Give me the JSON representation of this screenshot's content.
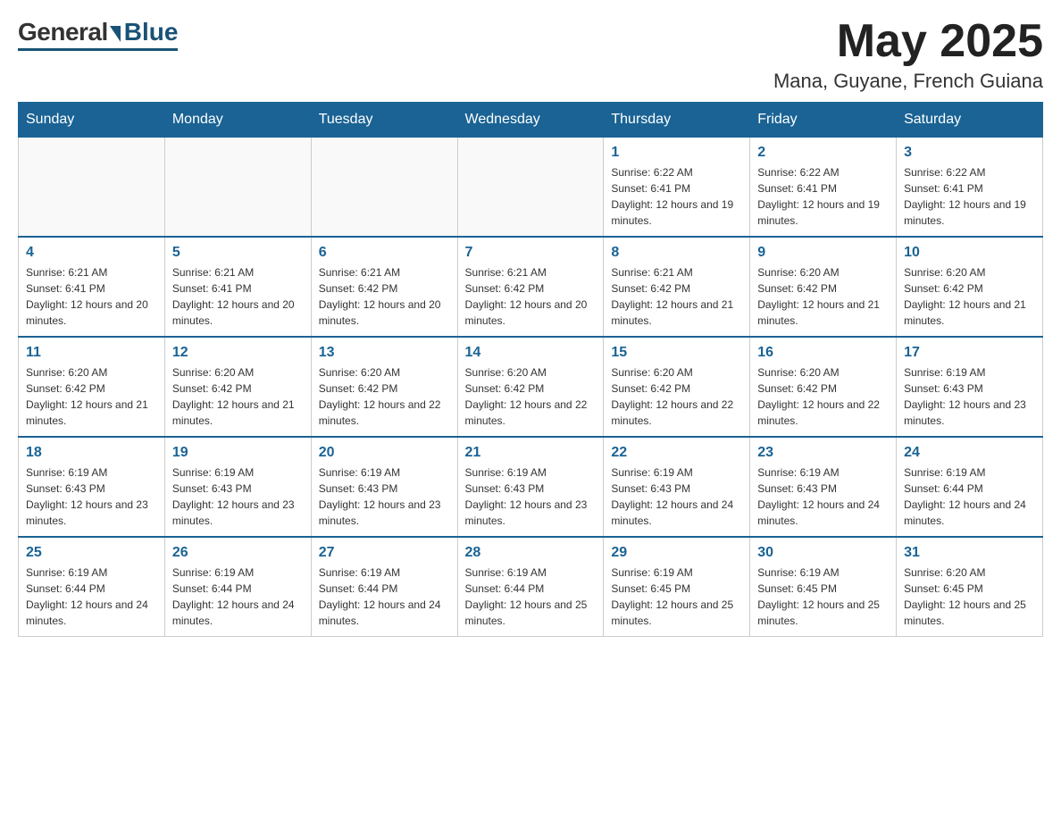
{
  "header": {
    "logo": {
      "general": "General",
      "blue": "Blue"
    },
    "title": "May 2025",
    "location": "Mana, Guyane, French Guiana"
  },
  "weekdays": [
    "Sunday",
    "Monday",
    "Tuesday",
    "Wednesday",
    "Thursday",
    "Friday",
    "Saturday"
  ],
  "weeks": [
    [
      {
        "day": "",
        "info": ""
      },
      {
        "day": "",
        "info": ""
      },
      {
        "day": "",
        "info": ""
      },
      {
        "day": "",
        "info": ""
      },
      {
        "day": "1",
        "info": "Sunrise: 6:22 AM\nSunset: 6:41 PM\nDaylight: 12 hours and 19 minutes."
      },
      {
        "day": "2",
        "info": "Sunrise: 6:22 AM\nSunset: 6:41 PM\nDaylight: 12 hours and 19 minutes."
      },
      {
        "day": "3",
        "info": "Sunrise: 6:22 AM\nSunset: 6:41 PM\nDaylight: 12 hours and 19 minutes."
      }
    ],
    [
      {
        "day": "4",
        "info": "Sunrise: 6:21 AM\nSunset: 6:41 PM\nDaylight: 12 hours and 20 minutes."
      },
      {
        "day": "5",
        "info": "Sunrise: 6:21 AM\nSunset: 6:41 PM\nDaylight: 12 hours and 20 minutes."
      },
      {
        "day": "6",
        "info": "Sunrise: 6:21 AM\nSunset: 6:42 PM\nDaylight: 12 hours and 20 minutes."
      },
      {
        "day": "7",
        "info": "Sunrise: 6:21 AM\nSunset: 6:42 PM\nDaylight: 12 hours and 20 minutes."
      },
      {
        "day": "8",
        "info": "Sunrise: 6:21 AM\nSunset: 6:42 PM\nDaylight: 12 hours and 21 minutes."
      },
      {
        "day": "9",
        "info": "Sunrise: 6:20 AM\nSunset: 6:42 PM\nDaylight: 12 hours and 21 minutes."
      },
      {
        "day": "10",
        "info": "Sunrise: 6:20 AM\nSunset: 6:42 PM\nDaylight: 12 hours and 21 minutes."
      }
    ],
    [
      {
        "day": "11",
        "info": "Sunrise: 6:20 AM\nSunset: 6:42 PM\nDaylight: 12 hours and 21 minutes."
      },
      {
        "day": "12",
        "info": "Sunrise: 6:20 AM\nSunset: 6:42 PM\nDaylight: 12 hours and 21 minutes."
      },
      {
        "day": "13",
        "info": "Sunrise: 6:20 AM\nSunset: 6:42 PM\nDaylight: 12 hours and 22 minutes."
      },
      {
        "day": "14",
        "info": "Sunrise: 6:20 AM\nSunset: 6:42 PM\nDaylight: 12 hours and 22 minutes."
      },
      {
        "day": "15",
        "info": "Sunrise: 6:20 AM\nSunset: 6:42 PM\nDaylight: 12 hours and 22 minutes."
      },
      {
        "day": "16",
        "info": "Sunrise: 6:20 AM\nSunset: 6:42 PM\nDaylight: 12 hours and 22 minutes."
      },
      {
        "day": "17",
        "info": "Sunrise: 6:19 AM\nSunset: 6:43 PM\nDaylight: 12 hours and 23 minutes."
      }
    ],
    [
      {
        "day": "18",
        "info": "Sunrise: 6:19 AM\nSunset: 6:43 PM\nDaylight: 12 hours and 23 minutes."
      },
      {
        "day": "19",
        "info": "Sunrise: 6:19 AM\nSunset: 6:43 PM\nDaylight: 12 hours and 23 minutes."
      },
      {
        "day": "20",
        "info": "Sunrise: 6:19 AM\nSunset: 6:43 PM\nDaylight: 12 hours and 23 minutes."
      },
      {
        "day": "21",
        "info": "Sunrise: 6:19 AM\nSunset: 6:43 PM\nDaylight: 12 hours and 23 minutes."
      },
      {
        "day": "22",
        "info": "Sunrise: 6:19 AM\nSunset: 6:43 PM\nDaylight: 12 hours and 24 minutes."
      },
      {
        "day": "23",
        "info": "Sunrise: 6:19 AM\nSunset: 6:43 PM\nDaylight: 12 hours and 24 minutes."
      },
      {
        "day": "24",
        "info": "Sunrise: 6:19 AM\nSunset: 6:44 PM\nDaylight: 12 hours and 24 minutes."
      }
    ],
    [
      {
        "day": "25",
        "info": "Sunrise: 6:19 AM\nSunset: 6:44 PM\nDaylight: 12 hours and 24 minutes."
      },
      {
        "day": "26",
        "info": "Sunrise: 6:19 AM\nSunset: 6:44 PM\nDaylight: 12 hours and 24 minutes."
      },
      {
        "day": "27",
        "info": "Sunrise: 6:19 AM\nSunset: 6:44 PM\nDaylight: 12 hours and 24 minutes."
      },
      {
        "day": "28",
        "info": "Sunrise: 6:19 AM\nSunset: 6:44 PM\nDaylight: 12 hours and 25 minutes."
      },
      {
        "day": "29",
        "info": "Sunrise: 6:19 AM\nSunset: 6:45 PM\nDaylight: 12 hours and 25 minutes."
      },
      {
        "day": "30",
        "info": "Sunrise: 6:19 AM\nSunset: 6:45 PM\nDaylight: 12 hours and 25 minutes."
      },
      {
        "day": "31",
        "info": "Sunrise: 6:20 AM\nSunset: 6:45 PM\nDaylight: 12 hours and 25 minutes."
      }
    ]
  ]
}
